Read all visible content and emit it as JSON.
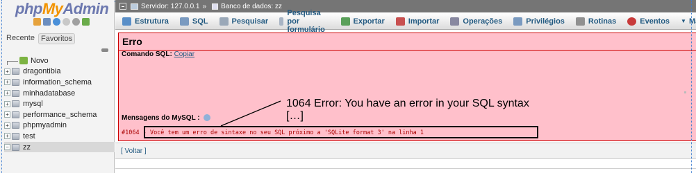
{
  "sidebar": {
    "logo": {
      "php": "php",
      "my": "My",
      "admin": "Admin"
    },
    "nav_icons": [
      "home-icon",
      "db-icon",
      "query-icon",
      "docs-icon",
      "settings-icon",
      "reload-icon"
    ],
    "tabs": {
      "recent": "Recente",
      "favorites": "Favoritos"
    },
    "new_label": "Novo",
    "databases": [
      "dragontibia",
      "information_schema",
      "minhadatabase",
      "mysql",
      "performance_schema",
      "phpmyadmin",
      "test",
      "zz"
    ],
    "selected_db": "zz"
  },
  "topbar": {
    "server": "Servidor: 127.0.0.1",
    "separator": "»",
    "database": "Banco de dados: zz"
  },
  "menu": [
    {
      "label": "Estrutura",
      "icon": "structure-icon",
      "color": "#5a8fc8"
    },
    {
      "label": "SQL",
      "icon": "sql-icon",
      "color": "#7a9ac0"
    },
    {
      "label": "Pesquisar",
      "icon": "search-icon",
      "color": "#9aa8b8"
    },
    {
      "label": "Pesquisa por formulário",
      "icon": "query-form-icon",
      "color": "#a8b4c4"
    },
    {
      "label": "Exportar",
      "icon": "export-icon",
      "color": "#5aa05a"
    },
    {
      "label": "Importar",
      "icon": "import-icon",
      "color": "#c85050"
    },
    {
      "label": "Operações",
      "icon": "wrench-icon",
      "color": "#8888a0"
    },
    {
      "label": "Privilégios",
      "icon": "privileges-icon",
      "color": "#7a9ac0"
    },
    {
      "label": "Rotinas",
      "icon": "routines-icon",
      "color": "#909090"
    },
    {
      "label": "Eventos",
      "icon": "events-icon",
      "color": "#c83a3a"
    },
    {
      "label": "Mais",
      "icon": "chevron-down-icon",
      "color": "#444444"
    }
  ],
  "error": {
    "title": "Erro",
    "sql_command_label": "Comando SQL:",
    "copy_link": "Copiar",
    "mysql_messages_label": "Mensagens do MySQL :",
    "error_code": "#1064 - ",
    "error_text": "Você tem um erro de sintaxe no seu SQL próximo a 'SQLite format 3' na linha 1"
  },
  "annotation": {
    "line1": "1064 Error: You have an error in your SQL syntax",
    "line2": "[…]"
  },
  "voltar": "[ Voltar ]",
  "colors": {
    "error_bg": "#ffc0cb",
    "error_border": "#cc0000",
    "link": "#235a81",
    "topbar": "#757575"
  }
}
